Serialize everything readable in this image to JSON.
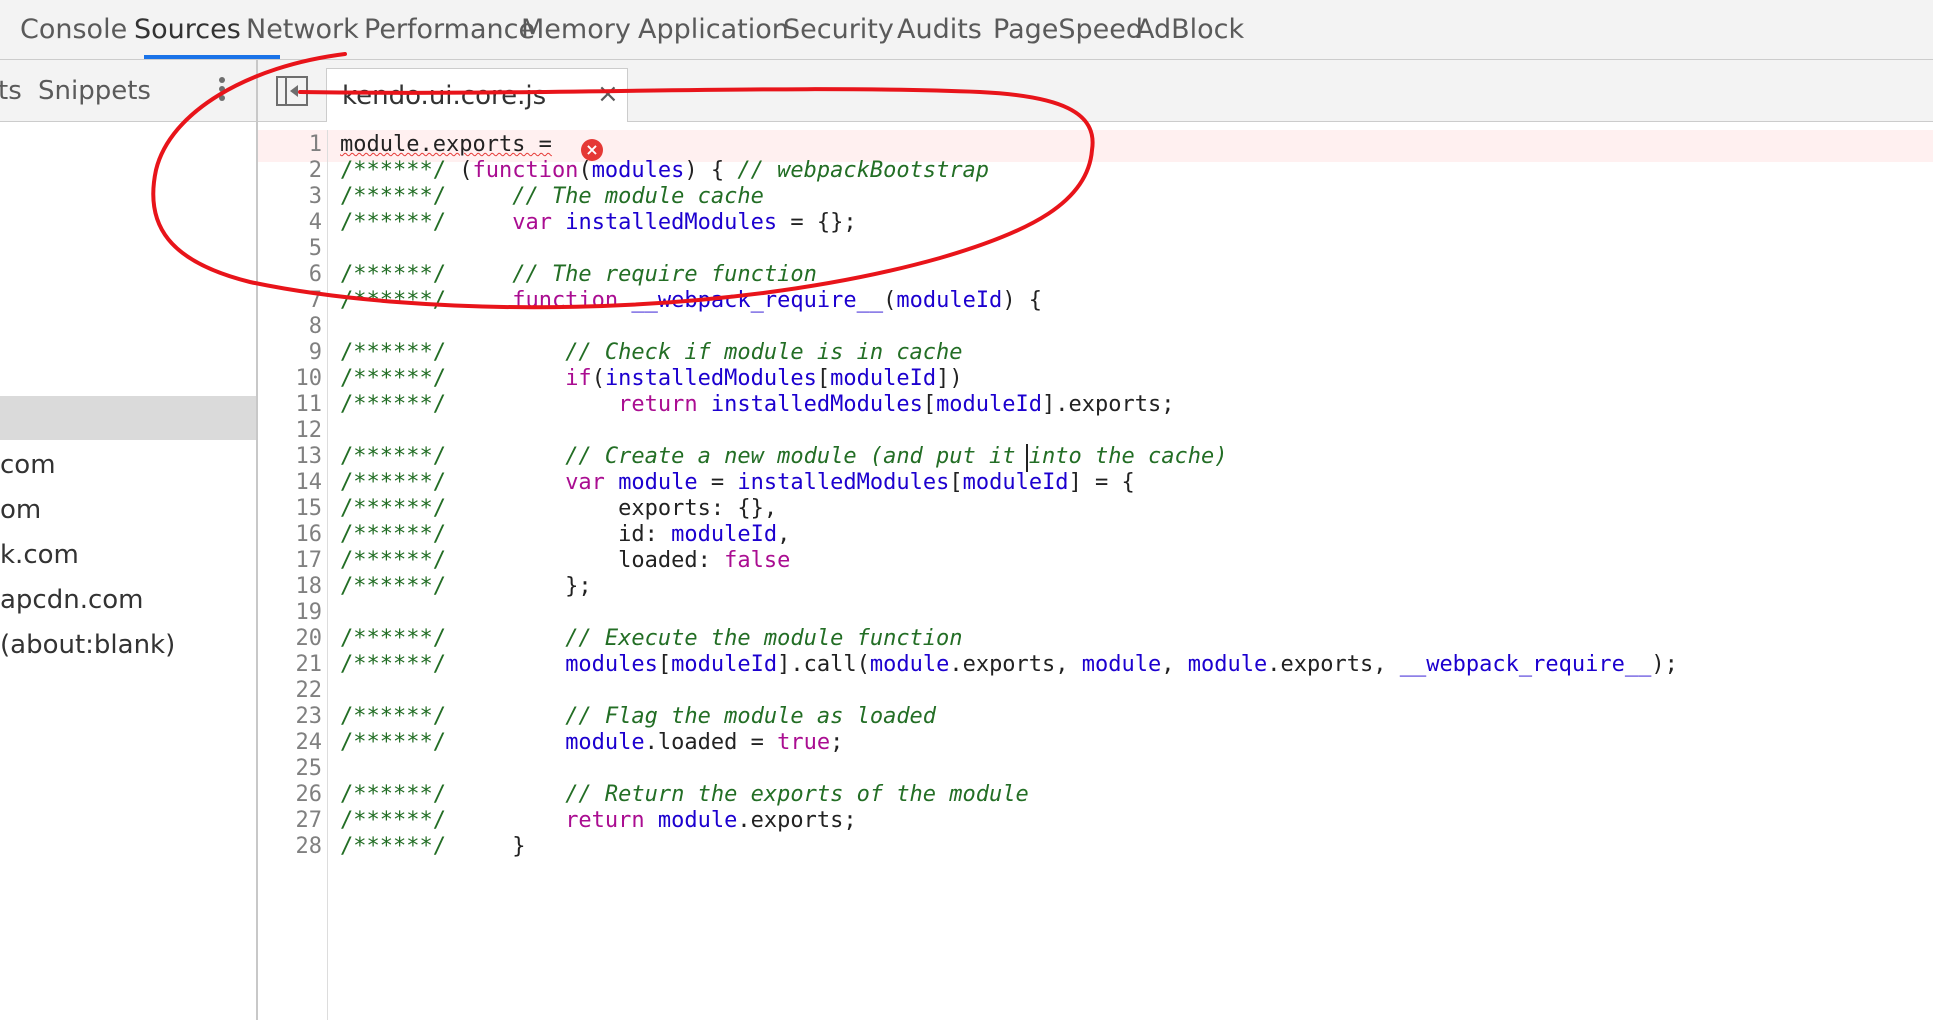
{
  "toolbar": {
    "tabs": [
      {
        "label": "Console",
        "active": false
      },
      {
        "label": "Sources",
        "active": true
      },
      {
        "label": "Network",
        "active": false
      },
      {
        "label": "Performance",
        "active": false
      },
      {
        "label": "Memory",
        "active": false
      },
      {
        "label": "Application",
        "active": false
      },
      {
        "label": "Security",
        "active": false
      },
      {
        "label": "Audits",
        "active": false
      },
      {
        "label": "PageSpeed",
        "active": false
      },
      {
        "label": "AdBlock",
        "active": false
      }
    ]
  },
  "sidebar": {
    "tab_partial": "ts",
    "tab_snippets": "Snippets",
    "more_icon": "kebab-menu-icon",
    "items": [
      "com",
      "om",
      "k.com",
      "apcdn.com",
      "(about:blank)"
    ]
  },
  "editor": {
    "navigator_icon": "toggle-navigator-icon",
    "file_tab": {
      "name": "kendo.ui.core.js",
      "close_icon": "close-icon",
      "close_glyph": "×"
    },
    "error_icon": "error-icon",
    "lines": [
      "module.exports =",
      "/******/ (function(modules) { // webpackBootstrap",
      "/******/ \t// The module cache",
      "/******/ \tvar installedModules = {};",
      "",
      "/******/ \t// The require function",
      "/******/ \tfunction __webpack_require__(moduleId) {",
      "",
      "/******/ \t\t// Check if module is in cache",
      "/******/ \t\tif(installedModules[moduleId])",
      "/******/ \t\t\treturn installedModules[moduleId].exports;",
      "",
      "/******/ \t\t// Create a new module (and put it into the cache)",
      "/******/ \t\tvar module = installedModules[moduleId] = {",
      "/******/ \t\t\texports: {},",
      "/******/ \t\t\tid: moduleId,",
      "/******/ \t\t\tloaded: false",
      "/******/ \t\t};",
      "",
      "/******/ \t\t// Execute the module function",
      "/******/ \t\tmodules[moduleId].call(module.exports, module, module.exports, __webpack_require__);",
      "",
      "/******/ \t\t// Flag the module as loaded",
      "/******/ \t\tmodule.loaded = true;",
      "",
      "/******/ \t\t// Return the exports of the module",
      "/******/ \t\treturn module.exports;",
      "/******/ \t}"
    ]
  },
  "colors": {
    "active_tab_underline": "#1a73e8",
    "annotation": "#e8141a",
    "error": "#e53935",
    "comment": "#236e25",
    "keyword": "#aa0d91",
    "identifier": "#1c00cf",
    "plain": "#222222"
  }
}
